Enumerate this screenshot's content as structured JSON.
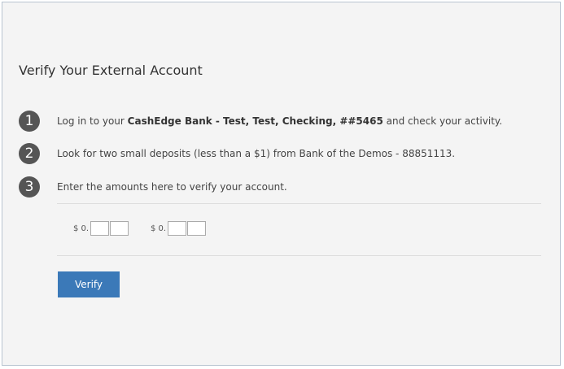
{
  "title": "Verify Your External Account",
  "steps": [
    {
      "number": "1",
      "text_before": "Log in to your ",
      "text_bold": "CashEdge Bank - Test, Test, Checking, ##5465",
      "text_after": " and check your activity."
    },
    {
      "number": "2",
      "text": "Look for two small deposits (less than a $1) from Bank of the Demos - 88851113."
    },
    {
      "number": "3",
      "text": "Enter the amounts here to verify your account."
    }
  ],
  "amounts": [
    {
      "prefix": "$ 0.",
      "digit1": "",
      "digit2": ""
    },
    {
      "prefix": "$ 0.",
      "digit1": "",
      "digit2": ""
    }
  ],
  "verify_button": {
    "label": "Verify"
  }
}
